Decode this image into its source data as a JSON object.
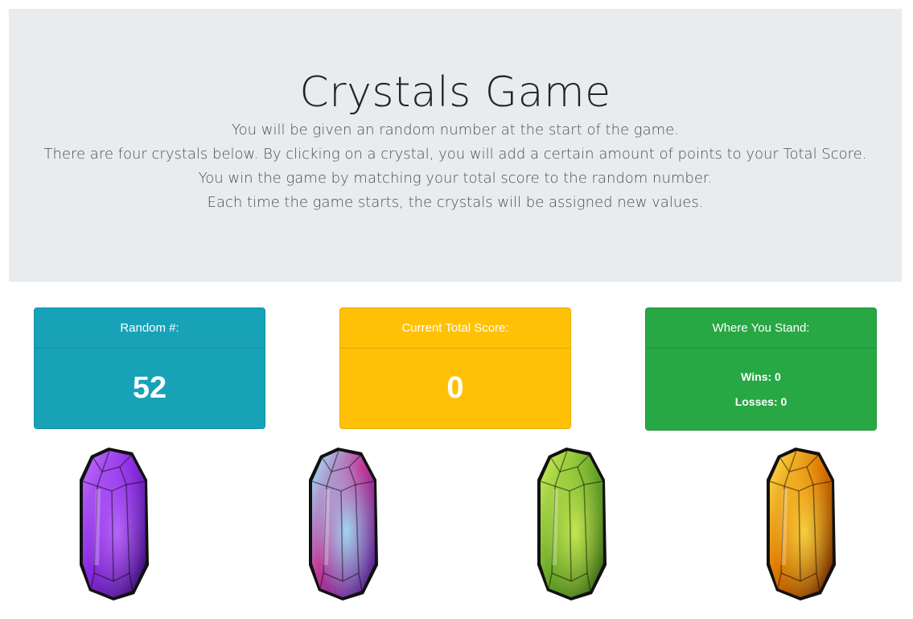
{
  "header": {
    "title": "Crystals Game",
    "instructions": [
      "You will be given an random number at the start of the game.",
      "There are four crystals below. By clicking on a crystal, you will add a certain amount of points to your Total Score.",
      "You win the game by matching your total score to the random number.",
      "Each time the game starts, the crystals will be assigned new values."
    ]
  },
  "cards": {
    "random": {
      "label": "Random #:",
      "value": "52",
      "color": "#17a2b8"
    },
    "score": {
      "label": "Current Total Score:",
      "value": "0",
      "color": "#ffc107"
    },
    "standing": {
      "label": "Where You Stand:",
      "wins": "Wins: 0",
      "losses": "Losses: 0",
      "color": "#28a745"
    }
  },
  "crystals": [
    {
      "name": "purple-crystal",
      "colors": [
        "#2a0a5e",
        "#8a2be2",
        "#c070ff"
      ]
    },
    {
      "name": "blue-crystal",
      "colors": [
        "#3a1a8a",
        "#c03a9a",
        "#9ef0ff"
      ]
    },
    {
      "name": "green-crystal",
      "colors": [
        "#2f5a12",
        "#6fae2a",
        "#d4f25a"
      ]
    },
    {
      "name": "orange-crystal",
      "colors": [
        "#5a1a00",
        "#e07a00",
        "#ffe14a"
      ]
    }
  ]
}
